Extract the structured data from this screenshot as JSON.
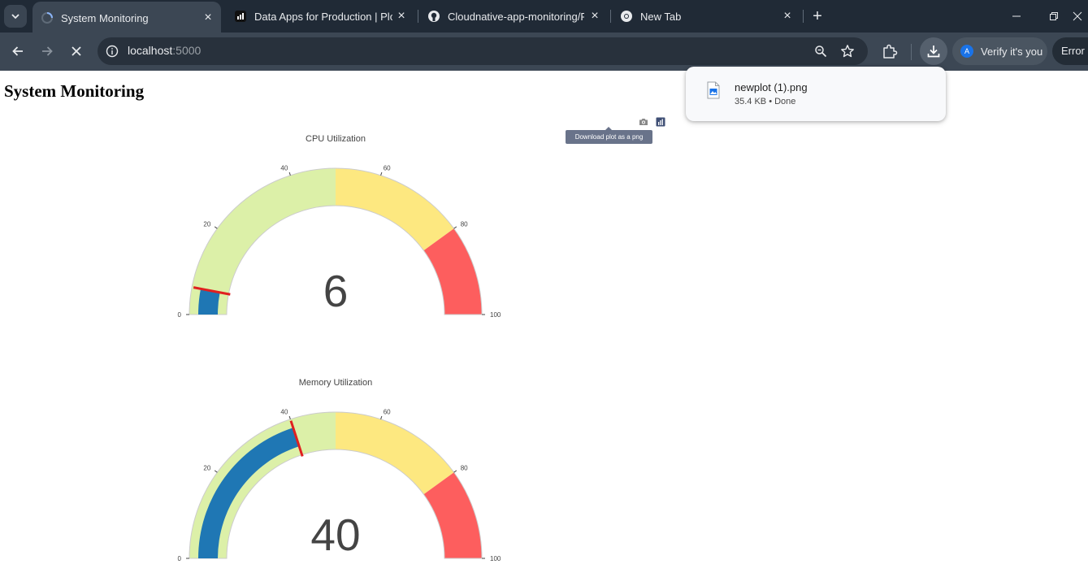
{
  "browser": {
    "tabs": [
      {
        "title": "System Monitoring",
        "favicon": "loading-spinner-icon",
        "active": true
      },
      {
        "title": "Data Apps for Production | Plotl",
        "favicon": "plotly-icon",
        "active": false
      },
      {
        "title": "Cloudnative-app-monitoring/RE",
        "favicon": "github-icon",
        "active": false
      },
      {
        "title": "New Tab",
        "favicon": "chrome-icon",
        "active": false
      }
    ],
    "url_host": "localhost",
    "url_port": ":5000",
    "profile_label": "Verify it's you",
    "profile_initial": "A",
    "error_label": "Error"
  },
  "download": {
    "filename": "newplot (1).png",
    "status": "35.4 KB • Done"
  },
  "page": {
    "title": "System Monitoring",
    "tooltip": "Download plot as a png"
  },
  "colors": {
    "band_low": "#dcf0a8",
    "band_mid": "#fde880",
    "band_high": "#fd5e5e",
    "bar": "#1f77b4",
    "threshold": "#e02020",
    "number": "#444444"
  },
  "chart_data": [
    {
      "type": "gauge",
      "title": "CPU Utilization",
      "value": 6,
      "value_label": "6",
      "range": [
        0,
        100
      ],
      "ticks": [
        "0",
        "20",
        "40",
        "60",
        "80",
        "100"
      ],
      "steps": [
        {
          "range": [
            0,
            50
          ],
          "color": "band_low"
        },
        {
          "range": [
            50,
            80
          ],
          "color": "band_mid"
        },
        {
          "range": [
            80,
            100
          ],
          "color": "band_high"
        }
      ],
      "threshold": 6
    },
    {
      "type": "gauge",
      "title": "Memory Utilization",
      "value": 40,
      "value_label": "40",
      "range": [
        0,
        100
      ],
      "ticks": [
        "0",
        "20",
        "40",
        "60",
        "80",
        "100"
      ],
      "steps": [
        {
          "range": [
            0,
            50
          ],
          "color": "band_low"
        },
        {
          "range": [
            50,
            80
          ],
          "color": "band_mid"
        },
        {
          "range": [
            80,
            100
          ],
          "color": "band_high"
        }
      ],
      "threshold": 40
    }
  ]
}
